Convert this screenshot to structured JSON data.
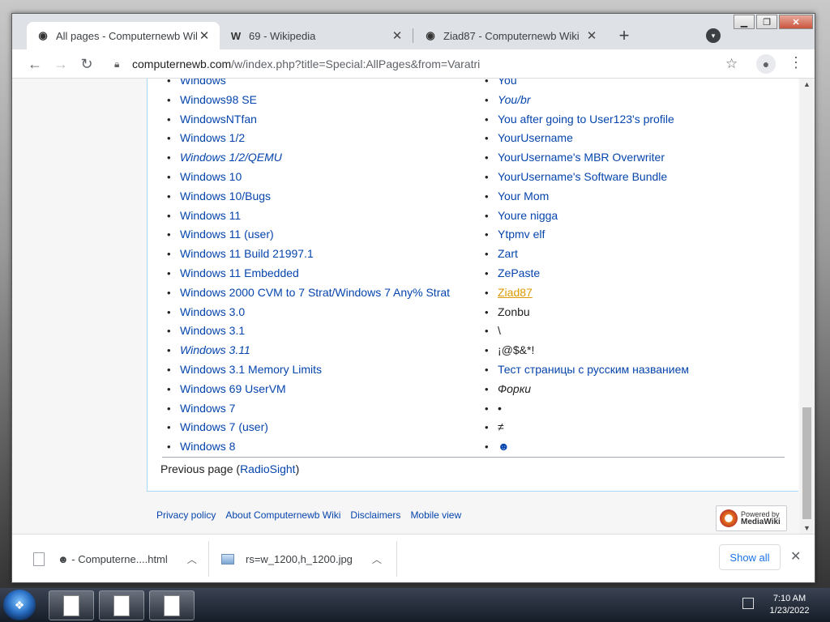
{
  "tabs": [
    {
      "title": "All pages - Computernewb Wiki",
      "favicon": "wiki-globe-icon",
      "active": true
    },
    {
      "title": "69 - Wikipedia",
      "favicon": "W",
      "active": false
    },
    {
      "title": "Ziad87 - Computernewb Wiki",
      "favicon": "wiki-globe-icon",
      "active": false
    }
  ],
  "address_bar": {
    "url_host": "computernewb.com",
    "url_path": "/w/index.php?title=Special:AllPages&from=Varatri"
  },
  "left_column": [
    {
      "text": "Windows",
      "style": "link"
    },
    {
      "text": "Windows98 SE",
      "style": "link"
    },
    {
      "text": "WindowsNTfan",
      "style": "link"
    },
    {
      "text": "Windows 1/2",
      "style": "link"
    },
    {
      "text": "Windows 1/2/QEMU",
      "style": "redirect"
    },
    {
      "text": "Windows 10",
      "style": "link"
    },
    {
      "text": "Windows 10/Bugs",
      "style": "link"
    },
    {
      "text": "Windows 11",
      "style": "link"
    },
    {
      "text": "Windows 11 (user)",
      "style": "link"
    },
    {
      "text": "Windows 11 Build 21997.1",
      "style": "link"
    },
    {
      "text": "Windows 11 Embedded",
      "style": "link"
    },
    {
      "text": "Windows 2000 CVM to 7 Strat/Windows 7 Any% Strat",
      "style": "link"
    },
    {
      "text": "Windows 3.0",
      "style": "link"
    },
    {
      "text": "Windows 3.1",
      "style": "link"
    },
    {
      "text": "Windows 3.11",
      "style": "redirect"
    },
    {
      "text": "Windows 3.1 Memory Limits",
      "style": "link"
    },
    {
      "text": "Windows 69 UserVM",
      "style": "link"
    },
    {
      "text": "Windows 7",
      "style": "link"
    },
    {
      "text": "Windows 7 (user)",
      "style": "link"
    },
    {
      "text": "Windows 8",
      "style": "link"
    }
  ],
  "right_column": [
    {
      "text": "You",
      "style": "link"
    },
    {
      "text": "You/br",
      "style": "redirect"
    },
    {
      "text": "You after going to User123's profile",
      "style": "link"
    },
    {
      "text": "YourUsername",
      "style": "link"
    },
    {
      "text": "YourUsername's MBR Overwriter",
      "style": "link"
    },
    {
      "text": "YourUsername's Software Bundle",
      "style": "link"
    },
    {
      "text": "Your Mom",
      "style": "link"
    },
    {
      "text": "Youre nigga",
      "style": "link"
    },
    {
      "text": "Ytpmv elf",
      "style": "link"
    },
    {
      "text": "Zart",
      "style": "link"
    },
    {
      "text": "ZePaste",
      "style": "link"
    },
    {
      "text": "Ziad87",
      "style": "new"
    },
    {
      "text": "Zonbu",
      "style": "plain"
    },
    {
      "text": "\\",
      "style": "plain"
    },
    {
      "text": "¡@$&*!",
      "style": "plain"
    },
    {
      "text": "Тест страницы с русским названием",
      "style": "link"
    },
    {
      "text": "Форки",
      "style": "plain-italic"
    },
    {
      "text": "•",
      "style": "plain"
    },
    {
      "text": "≠",
      "style": "plain"
    },
    {
      "text": "☻",
      "style": "link"
    }
  ],
  "prev_page": {
    "prefix": "Previous page (",
    "link": "RadioSight",
    "suffix": ")"
  },
  "footer_links": [
    "Privacy policy",
    "About Computernewb Wiki",
    "Disclaimers",
    "Mobile view"
  ],
  "powered_by": {
    "line1": "Powered by",
    "line2": "MediaWiki"
  },
  "downloads": [
    {
      "name": "☻ - Computerne....html",
      "icon": "file-icon"
    },
    {
      "name": "rs=w_1200,h_1200.jpg",
      "icon": "image-icon"
    }
  ],
  "show_all_label": "Show all",
  "clock": {
    "time": "7:10 AM",
    "date": "1/23/2022"
  }
}
